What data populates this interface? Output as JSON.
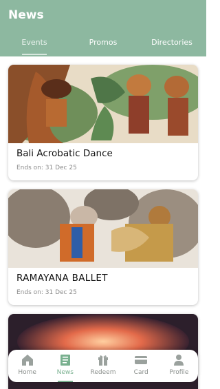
{
  "header": {
    "title": "News"
  },
  "tabs": [
    {
      "label": "Events"
    },
    {
      "label": "Promos"
    },
    {
      "label": "Directories"
    }
  ],
  "events": [
    {
      "title": "Bali Acrobatic Dance",
      "ends": "Ends on: 31 Dec 25",
      "image": "bali-dancers-photo"
    },
    {
      "title": "RAMAYANA BALLET",
      "ends": "Ends on: 31 Dec 25",
      "image": "ramayana-dancers-photo"
    },
    {
      "image": "sunset-photo"
    }
  ],
  "bottom_nav": [
    {
      "label": "Home",
      "icon": "home-icon"
    },
    {
      "label": "News",
      "icon": "news-icon",
      "active": true
    },
    {
      "label": "Redeem",
      "icon": "gift-icon"
    },
    {
      "label": "Card",
      "icon": "card-icon"
    },
    {
      "label": "Profile",
      "icon": "profile-icon"
    }
  ],
  "colors": {
    "header": "#8db8a0",
    "accent": "#79b08f"
  }
}
